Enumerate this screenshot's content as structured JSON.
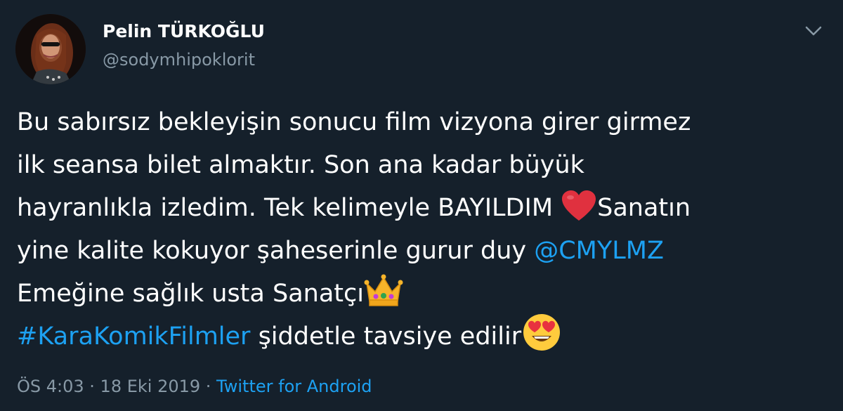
{
  "user": {
    "name": "Pelin TÜRKOĞLU",
    "handle": "@sodymhipoklorit"
  },
  "icons": {
    "avatar": "profile-photo",
    "caret": "chevron-down-icon",
    "heart": "red-heart-emoji",
    "crown": "crown-emoji",
    "smile": "heart-eyes-emoji"
  },
  "tweet": {
    "line1": "Bu sabırsız bekleyişin sonucu film vizyona girer girmez",
    "line2": "ilk seansa bilet almaktır. Son ana kadar büyük",
    "line3_before": "hayranlıkla izledim. Tek kelimeyle BAYILDIM ",
    "line3_after": "Sanatın",
    "line4_before": "yine kalite kokuyor şaheserinle gurur duy ",
    "mention": "@CMYLMZ",
    "line5": " Emeğine sağlık usta Sanatçı",
    "hashtag": "#KaraKomikFilmler",
    "line6_after": " şiddetle tavsiye edilir"
  },
  "meta": {
    "time": "ÖS 4:03",
    "separator1": " · ",
    "date": "18 Eki 2019",
    "separator2": " · ",
    "source": "Twitter for Android"
  },
  "colors": {
    "background": "#15202b",
    "text": "#ffffff",
    "secondary": "#8899a6",
    "link": "#1da1f2"
  }
}
